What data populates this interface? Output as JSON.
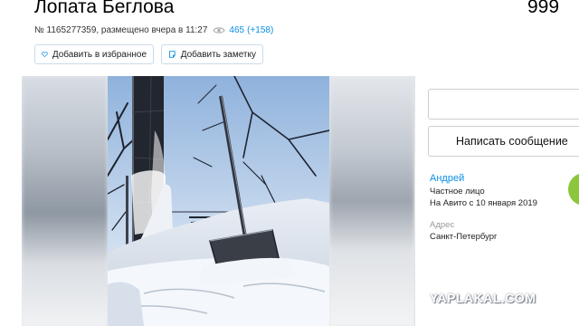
{
  "listing": {
    "title": "Лопата Беглова",
    "price": "999",
    "id_text": "№ 1165277359, размещено вчера в 11:27",
    "views_count": "465",
    "views_delta": "(+158)"
  },
  "actions": {
    "favorite_label": "Добавить в избранное",
    "note_label": "Добавить заметку"
  },
  "sidebar": {
    "write_label": "Написать сообщение",
    "seller_name": "Андрей",
    "seller_type": "Частное лицо",
    "seller_since": "На Авито с 10 января 2019",
    "address_label": "Адрес",
    "address_value": "Санкт-Петербург"
  },
  "watermark": "YAPLAKAL.COM",
  "colors": {
    "link_blue": "#0a8fe6",
    "avatar_green": "#8cc63f",
    "button_border": "#c9dbea"
  },
  "icons": {
    "views": "eye-icon",
    "favorite": "heart-icon",
    "note": "note-icon"
  }
}
